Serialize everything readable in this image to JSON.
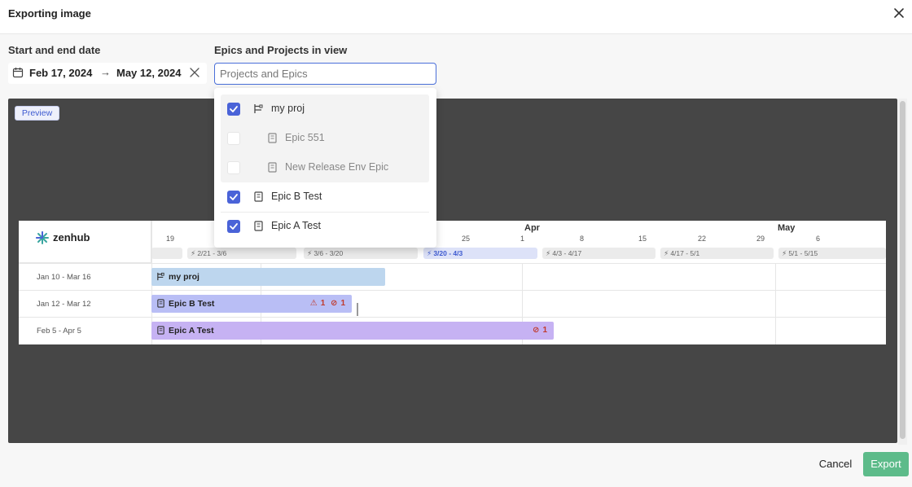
{
  "window": {
    "title": "Exporting image"
  },
  "date_range": {
    "label": "Start and end date",
    "start": "Feb 17, 2024",
    "arrow": "→",
    "end": "May 12, 2024"
  },
  "filter": {
    "label": "Epics and Projects in view",
    "placeholder": "Projects and Epics",
    "value": "",
    "options": [
      {
        "label": "my proj",
        "checked": true,
        "icon": "project-icon"
      },
      {
        "label": "Epic 551",
        "checked": false,
        "icon": "epic-icon"
      },
      {
        "label": "New Release Env Epic",
        "checked": false,
        "icon": "epic-icon"
      },
      {
        "label": "Epic B Test",
        "checked": true,
        "icon": "epic-icon"
      },
      {
        "label": "Epic A Test",
        "checked": true,
        "icon": "epic-icon"
      }
    ]
  },
  "preview": {
    "badge": "Preview"
  },
  "roadmap": {
    "logo_text": "zenhub",
    "months": [
      "Apr",
      "May"
    ],
    "weeks": [
      "19",
      "25",
      "1",
      "8",
      "15",
      "22",
      "29",
      "6"
    ],
    "sprints": [
      {
        "label": "2/21 - 3/6",
        "active": false
      },
      {
        "label": "3/6 - 3/20",
        "active": false
      },
      {
        "label": "3/20 - 4/3",
        "active": true
      },
      {
        "label": "4/3 - 4/17",
        "active": false
      },
      {
        "label": "4/17 - 5/1",
        "active": false
      },
      {
        "label": "5/1 - 5/15",
        "active": false
      }
    ],
    "rows": [
      {
        "dates": "Jan 10 - Mar 16",
        "name": "my proj",
        "icon": "project-icon"
      },
      {
        "dates": "Jan 12 - Mar 12",
        "name": "Epic B Test",
        "icon": "epic-icon",
        "warnings": "1",
        "blocked": "1"
      },
      {
        "dates": "Feb 5 - Apr 5",
        "name": "Epic A Test",
        "icon": "epic-icon",
        "blocked": "1"
      }
    ]
  },
  "actions": {
    "cancel": "Cancel",
    "export": "Export"
  },
  "colors": {
    "accent": "#4a63d8",
    "export": "#5dbb8a",
    "preview_bg": "#464646"
  }
}
